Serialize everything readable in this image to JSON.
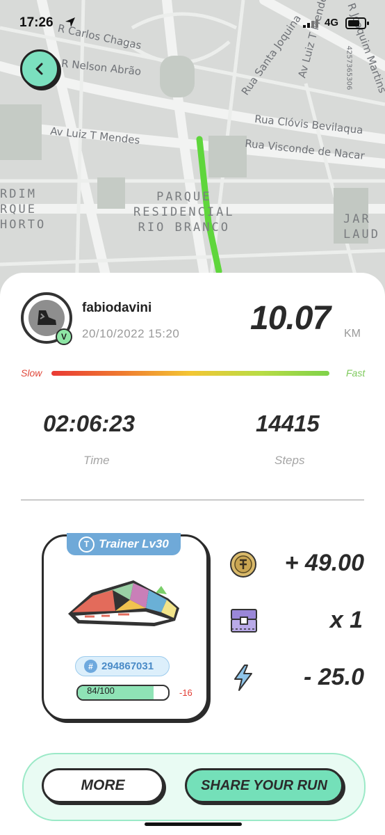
{
  "status_bar": {
    "time": "17:26",
    "network": "4G"
  },
  "map": {
    "streets": [
      "R Carlos Chagas",
      "R Nelson Abrão",
      "Av Luiz T Mendes",
      "Rua Clóvis Bevilaqua",
      "Rua Visconde de Nacar",
      "Rua Santa Joquina",
      "Av Luiz T Mendes",
      "R Joaquim Martins",
      "4257365306"
    ],
    "districts": [
      "PARQUE\nRESIDENCIAL\nRIO BRANCO",
      "RDIM\nRQUE\nHORTO",
      "JAR\nLAUD"
    ],
    "route_color": "#5fd63c"
  },
  "run": {
    "username": "fabiodavini",
    "datetime": "20/10/2022 15:20",
    "badge": "V",
    "distance": "10.07",
    "distance_unit": "KM",
    "speed_slow": "Slow",
    "speed_fast": "Fast",
    "time_value": "02:06:23",
    "time_label": "Time",
    "steps_value": "14415",
    "steps_label": "Steps"
  },
  "sneaker": {
    "tag_icon": "T",
    "tag": "Trainer Lv30",
    "id": "294867031",
    "durability_text": "84/100",
    "durability_fraction": 0.84,
    "durability_delta": "-16"
  },
  "rewards": [
    {
      "icon": "gst-coin-icon",
      "value": "+ 49.00"
    },
    {
      "icon": "mystery-box-icon",
      "value": "x 1"
    },
    {
      "icon": "energy-bolt-icon",
      "value": "- 25.0"
    }
  ],
  "buttons": {
    "more": "MORE",
    "share": "SHARE YOUR RUN"
  },
  "colors": {
    "accent": "#74e0b9",
    "tag_blue": "#6fa9d8",
    "slow": "#e93a35",
    "fast": "#7fd24a"
  }
}
